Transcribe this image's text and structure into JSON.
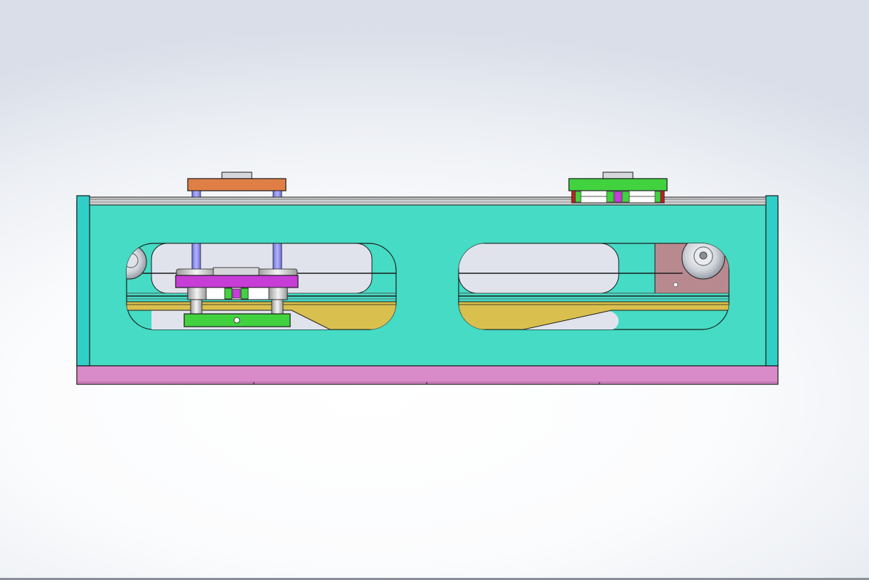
{
  "view": {
    "background_center": "#ffffff",
    "background_edge": "#d9dee8"
  },
  "colors": {
    "frame_body": "#45dbc4",
    "frame_end_caps": "#2fcfc7",
    "base_plate": "#d98bc9",
    "top_rail": "#c8c8c8",
    "bottom_guide": "#d9c04e",
    "left_carriage_top_plate": "#e07f45",
    "right_carriage_top_plate": "#42d240",
    "guide_rods": "#8b8df0",
    "lift_plate": "#c73ed6",
    "lower_plate": "#42d240",
    "pulley_block": "#b88a8f",
    "window_fill": "#e1e3ec",
    "outline": "#1b1b1b"
  },
  "components": [
    "frame-body",
    "base-plate",
    "top-rail",
    "end-cap-left",
    "end-cap-right",
    "window-left",
    "window-right",
    "carriage-left",
    "carriage-right",
    "lift-mechanism",
    "pulley-idler-left",
    "pulley-drive-right"
  ]
}
